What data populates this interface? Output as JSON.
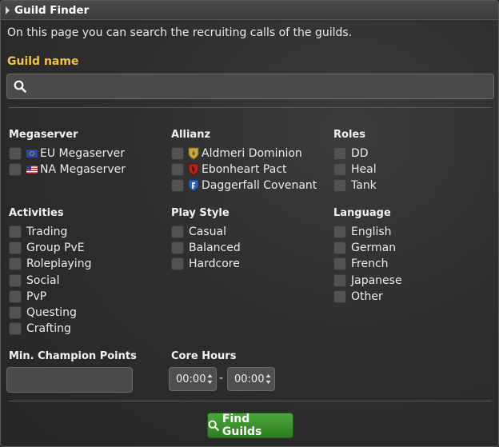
{
  "window": {
    "title": "Guild Finder"
  },
  "intro": "On this page you can search the recruiting calls of the guilds.",
  "guild_name": {
    "label": "Guild name",
    "value": "",
    "placeholder": ""
  },
  "megaserver": {
    "title": "Megaserver",
    "items": [
      "EU Megaserver",
      "NA Megaserver"
    ]
  },
  "allianz": {
    "title": "Allianz",
    "items": [
      "Aldmeri Dominion",
      "Ebonheart Pact",
      "Daggerfall Covenant"
    ]
  },
  "roles": {
    "title": "Roles",
    "items": [
      "DD",
      "Heal",
      "Tank"
    ]
  },
  "activities": {
    "title": "Activities",
    "items": [
      "Trading",
      "Group PvE",
      "Roleplaying",
      "Social",
      "PvP",
      "Questing",
      "Crafting"
    ]
  },
  "playstyle": {
    "title": "Play Style",
    "items": [
      "Casual",
      "Balanced",
      "Hardcore"
    ]
  },
  "language": {
    "title": "Language",
    "items": [
      "English",
      "German",
      "French",
      "Japanese",
      "Other"
    ]
  },
  "champion": {
    "label": "Min. Champion Points",
    "value": ""
  },
  "core_hours": {
    "label": "Core Hours",
    "from": "00:00",
    "separator": "-",
    "to": "00:00"
  },
  "find_button": {
    "label": "Find Guilds"
  },
  "colors": {
    "accent_label": "#f0c24b",
    "button_green": "#3a9a2d"
  }
}
